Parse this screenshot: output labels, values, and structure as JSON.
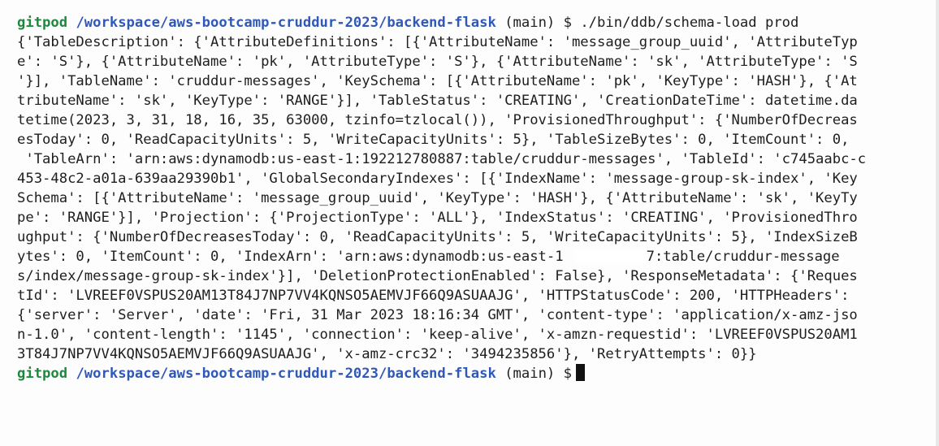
{
  "prompt1": {
    "user": "gitpod",
    "path": "/workspace/aws-bootcamp-cruddur-2023/backend-flask",
    "branch": " (main) $ ",
    "command": "./bin/ddb/schema-load prod"
  },
  "output": {
    "lines": [
      "{'TableDescription': {'AttributeDefinitions': [{'AttributeName': 'message_group_uuid', 'AttributeTyp",
      "e': 'S'}, {'AttributeName': 'pk', 'AttributeType': 'S'}, {'AttributeName': 'sk', 'AttributeType': 'S",
      "'}], 'TableName': 'cruddur-messages', 'KeySchema': [{'AttributeName': 'pk', 'KeyType': 'HASH'}, {'At",
      "tributeName': 'sk', 'KeyType': 'RANGE'}], 'TableStatus': 'CREATING', 'CreationDateTime': datetime.da",
      "tetime(2023, 3, 31, 18, 16, 35, 63000, tzinfo=tzlocal()), 'ProvisionedThroughput': {'NumberOfDecreas",
      "esToday': 0, 'ReadCapacityUnits': 5, 'WriteCapacityUnits': 5}, 'TableSizeBytes': 0, 'ItemCount': 0,",
      " 'TableArn': 'arn:aws:dynamodb:us-east-1:192212780887:table/cruddur-messages', 'TableId': 'c745aabc-c",
      "453-48c2-a01a-639aa29390b1', 'GlobalSecondaryIndexes': [{'IndexName': 'message-group-sk-index', 'Key",
      "Schema': [{'AttributeName': 'message_group_uuid', 'KeyType': 'HASH'}, {'AttributeName': 'sk', 'KeyTy",
      "pe': 'RANGE'}], 'Projection': {'ProjectionType': 'ALL'}, 'IndexStatus': 'CREATING', 'ProvisionedThro",
      "ughput': {'NumberOfDecreasesToday': 0, 'ReadCapacityUnits': 5, 'WriteCapacityUnits': 5}, 'IndexSizeB"
    ],
    "line12_start": "ytes': 0, 'ItemCount': 0, 'IndexArn': 'arn:aws:dynamodb:us-east-1",
    "line12_end": "7:table/cruddur-message",
    "lines_after": [
      "s/index/message-group-sk-index'}], 'DeletionProtectionEnabled': False}, 'ResponseMetadata': {'Reques",
      "tId': 'LVREEF0VSPUS20AM13T84J7NP7VV4KQNSO5AEMVJF66Q9ASUAAJG', 'HTTPStatusCode': 200, 'HTTPHeaders':",
      "{'server': 'Server', 'date': 'Fri, 31 Mar 2023 18:16:34 GMT', 'content-type': 'application/x-amz-jso",
      "n-1.0', 'content-length': '1145', 'connection': 'keep-alive', 'x-amzn-requestid': 'LVREEF0VSPUS20AM1",
      "3T84J7NP7VV4KQNSO5AEMVJF66Q9ASUAAJG', 'x-amz-crc32': '3494235856'}, 'RetryAttempts': 0}}"
    ]
  },
  "prompt2": {
    "user": "gitpod",
    "path": "/workspace/aws-bootcamp-cruddur-2023/backend-flask",
    "branch": " (main) $"
  }
}
